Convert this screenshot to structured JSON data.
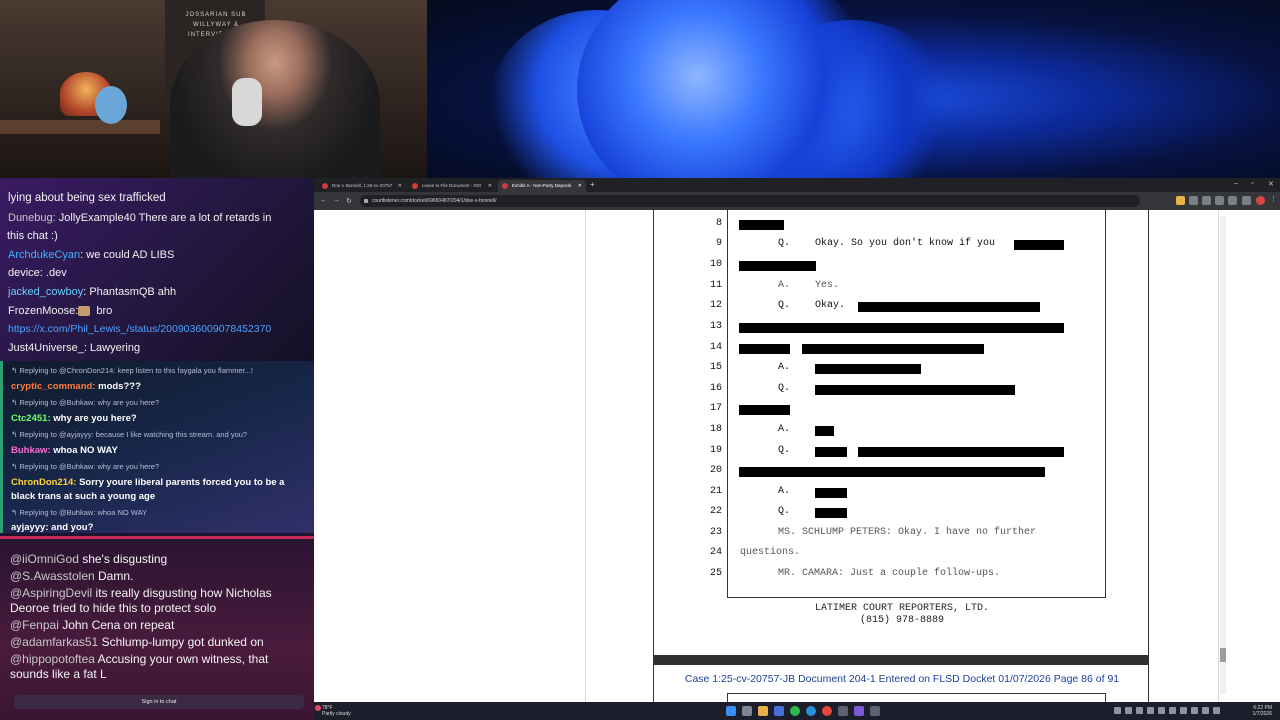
{
  "webcam": {
    "sign_lines": [
      "JOSSARIAN SUB",
      "WILLYWAY &",
      "INTERVIEWING"
    ]
  },
  "chat_top": [
    {
      "user": "",
      "text": "lying about being sex trafficked"
    },
    {
      "user": "Dunebug:",
      "text": " JollyExample40 There are a lot of retards in"
    },
    {
      "user": "",
      "text": "this chat :)"
    },
    {
      "user": "ArchdukeCyan",
      "text": ": we could AD LIBS"
    },
    {
      "user": "",
      "text": "device: .dev"
    },
    {
      "user": "jacked_cowboy",
      "text": ": PhantasmQB ahh"
    },
    {
      "user": "FrozenMoose:",
      "text": " bro"
    },
    {
      "user": "",
      "text": "https://x.com/Phil_Lewis_/status/2009036009078452370"
    },
    {
      "user": "Just4Universe_:",
      "text": " Lawyering"
    }
  ],
  "chat_mid": [
    {
      "reply": "Replying to @ChronDon214: keep listen to this faygala you flammer...!",
      "user": "cryptic_command:",
      "text": " mods???"
    },
    {
      "reply": "Replying to @Buhkaw: why are you here?",
      "user": "Ctc2451:",
      "text": " why are you here?"
    },
    {
      "reply": "Replying to @ayjayyy: because I like watching this stream. and you?",
      "user": "Buhkaw:",
      "text": " whoa NO WAY"
    },
    {
      "reply": "Replying to @Buhkaw: why are you here?",
      "user": "ChronDon214:",
      "text": " Sorry youre liberal parents forced you to be a",
      "text2": "black trans at such a young age"
    },
    {
      "reply": "Replying to @Buhkaw: whoa NO WAY",
      "user": "ayjayyy:",
      "text": " and you?"
    }
  ],
  "chat_bottom": [
    {
      "user": "@iiOmniGod",
      "text": " she's disgusting"
    },
    {
      "user": "@S.Awasstolen",
      "text": " Damn."
    },
    {
      "user": "@AspiringDevil",
      "text": " its really disgusting how Nicholas",
      "text2": "Deoroe tried to hide this to protect solo"
    },
    {
      "user": "@Fenpai",
      "text": " John Cena on repeat"
    },
    {
      "user": "@adamfarkas51",
      "text": " Schlump-lumpy got dunked on"
    },
    {
      "user": "@hippopotoftea",
      "text": " Accusing your own witness, that",
      "text2": "sounds like a fat L"
    }
  ],
  "chat_signin": "Sign in to chat",
  "browser": {
    "tabs": [
      "Doe v. Bonnell, 1:25-cv-20757",
      "Leave to File Document - #20",
      "Exhibit A - Non-Party Depositi"
    ],
    "url": "courtlistener.com/docket/69650487/204/1/doe-v-bonnell/"
  },
  "transcript": {
    "lines": [
      {
        "n": "8",
        "spk": "",
        "text": ""
      },
      {
        "n": "9",
        "spk": "Q.",
        "text": "Okay.  So you don't know if you"
      },
      {
        "n": "10",
        "spk": "",
        "text": ""
      },
      {
        "n": "11",
        "spk": "A.",
        "text": "Yes."
      },
      {
        "n": "12",
        "spk": "Q.",
        "text": "Okay."
      },
      {
        "n": "13",
        "spk": "",
        "text": ""
      },
      {
        "n": "14",
        "spk": "",
        "text": ""
      },
      {
        "n": "15",
        "spk": "A.",
        "text": ""
      },
      {
        "n": "16",
        "spk": "Q.",
        "text": ""
      },
      {
        "n": "17",
        "spk": "",
        "text": ""
      },
      {
        "n": "18",
        "spk": "A.",
        "text": ""
      },
      {
        "n": "19",
        "spk": "Q.",
        "text": ""
      },
      {
        "n": "20",
        "spk": "",
        "text": ""
      },
      {
        "n": "21",
        "spk": "A.",
        "text": ""
      },
      {
        "n": "22",
        "spk": "Q.",
        "text": ""
      },
      {
        "n": "23",
        "spk": "",
        "text": "MS. SCHLUMP PETERS:  Okay.  I have no further"
      },
      {
        "n": "24",
        "spk": "",
        "text": "questions."
      },
      {
        "n": "25",
        "spk": "",
        "text": "MR. CAMARA:  Just a couple follow-ups."
      }
    ],
    "footer1": "LATIMER COURT REPORTERS, LTD.",
    "footer2": "(815) 978-8889",
    "next_header": "Case 1:25-cv-20757-JB   Document 204-1   Entered on FLSD Docket 01/07/2026   Page 86 of 91"
  },
  "taskbar": {
    "weather_temp": "78°F",
    "weather_desc": "Partly cloudy",
    "time": "6:22 PM",
    "date": "1/7/2026"
  }
}
